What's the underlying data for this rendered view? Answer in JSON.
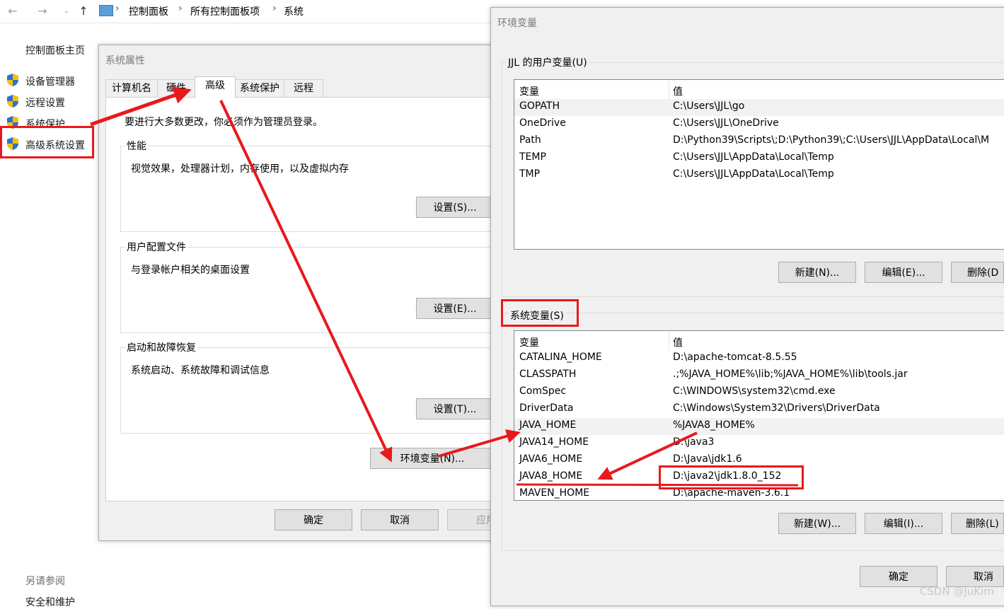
{
  "explorer": {
    "breadcrumb": [
      "控制面板",
      "所有控制面板项",
      "系统"
    ]
  },
  "left_panel": {
    "home": "控制面板主页",
    "links": [
      "设备管理器",
      "远程设置",
      "系统保护",
      "高级系统设置"
    ],
    "see_also": "另请参阅",
    "security": "安全和维护"
  },
  "sys_props": {
    "title": "系统属性",
    "tabs": [
      "计算机名",
      "硬件",
      "高级",
      "系统保护",
      "远程"
    ],
    "notice": "要进行大多数更改，你必须作为管理员登录。",
    "groups": [
      {
        "title": "性能",
        "desc": "视觉效果，处理器计划，内存使用，以及虚拟内存",
        "button": "设置(S)..."
      },
      {
        "title": "用户配置文件",
        "desc": "与登录帐户相关的桌面设置",
        "button": "设置(E)..."
      },
      {
        "title": "启动和故障恢复",
        "desc": "系统启动、系统故障和调试信息",
        "button": "设置(T)..."
      }
    ],
    "env_button": "环境变量(N)...",
    "ok": "确定",
    "cancel": "取消",
    "apply": "应用"
  },
  "env_vars": {
    "title": "环境变量",
    "user_group": "JJL 的用户变量(U)",
    "col_var": "变量",
    "col_val": "值",
    "user_vars": [
      {
        "name": "GOPATH",
        "value": "C:\\Users\\JJL\\go"
      },
      {
        "name": "OneDrive",
        "value": "C:\\Users\\JJL\\OneDrive"
      },
      {
        "name": "Path",
        "value": "D:\\Python39\\Scripts\\;D:\\Python39\\;C:\\Users\\JJL\\AppData\\Local\\M"
      },
      {
        "name": "TEMP",
        "value": "C:\\Users\\JJL\\AppData\\Local\\Temp"
      },
      {
        "name": "TMP",
        "value": "C:\\Users\\JJL\\AppData\\Local\\Temp"
      }
    ],
    "user_buttons": [
      "新建(N)...",
      "编辑(E)...",
      "删除(D"
    ],
    "sys_group": "系统变量(S)",
    "sys_vars": [
      {
        "name": "CATALINA_HOME",
        "value": "D:\\apache-tomcat-8.5.55"
      },
      {
        "name": "CLASSPATH",
        "value": ".;%JAVA_HOME%\\lib;%JAVA_HOME%\\lib\\tools.jar"
      },
      {
        "name": "ComSpec",
        "value": "C:\\WINDOWS\\system32\\cmd.exe"
      },
      {
        "name": "DriverData",
        "value": "C:\\Windows\\System32\\Drivers\\DriverData"
      },
      {
        "name": "JAVA_HOME",
        "value": "%JAVA8_HOME%"
      },
      {
        "name": "JAVA14_HOME",
        "value": "D:\\java3"
      },
      {
        "name": "JAVA6_HOME",
        "value": "D:\\Java\\jdk1.6"
      },
      {
        "name": "JAVA8_HOME",
        "value": "D:\\java2\\jdk1.8.0_152"
      },
      {
        "name": "MAVEN_HOME",
        "value": "D:\\apache-maven-3.6.1"
      }
    ],
    "sys_buttons": [
      "新建(W)...",
      "编辑(I)...",
      "删除(L)"
    ],
    "ok": "确定",
    "cancel": "取消"
  },
  "watermark": "CSDN @JuKim",
  "colors": {
    "annotation_red": "#e8191c",
    "dialog_bg": "#f0f0f0"
  }
}
